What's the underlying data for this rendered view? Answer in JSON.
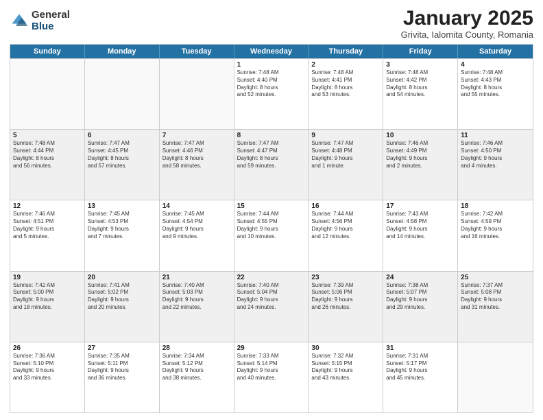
{
  "logo": {
    "general": "General",
    "blue": "Blue"
  },
  "title": "January 2025",
  "subtitle": "Grivita, Ialomita County, Romania",
  "days": [
    "Sunday",
    "Monday",
    "Tuesday",
    "Wednesday",
    "Thursday",
    "Friday",
    "Saturday"
  ],
  "weeks": [
    [
      {
        "day": "",
        "info": "",
        "shaded": false,
        "empty": true
      },
      {
        "day": "",
        "info": "",
        "shaded": false,
        "empty": true
      },
      {
        "day": "",
        "info": "",
        "shaded": false,
        "empty": true
      },
      {
        "day": "1",
        "info": "Sunrise: 7:48 AM\nSunset: 4:40 PM\nDaylight: 8 hours\nand 52 minutes.",
        "shaded": false,
        "empty": false
      },
      {
        "day": "2",
        "info": "Sunrise: 7:48 AM\nSunset: 4:41 PM\nDaylight: 8 hours\nand 53 minutes.",
        "shaded": false,
        "empty": false
      },
      {
        "day": "3",
        "info": "Sunrise: 7:48 AM\nSunset: 4:42 PM\nDaylight: 8 hours\nand 54 minutes.",
        "shaded": false,
        "empty": false
      },
      {
        "day": "4",
        "info": "Sunrise: 7:48 AM\nSunset: 4:43 PM\nDaylight: 8 hours\nand 55 minutes.",
        "shaded": false,
        "empty": false
      }
    ],
    [
      {
        "day": "5",
        "info": "Sunrise: 7:48 AM\nSunset: 4:44 PM\nDaylight: 8 hours\nand 56 minutes.",
        "shaded": true,
        "empty": false
      },
      {
        "day": "6",
        "info": "Sunrise: 7:47 AM\nSunset: 4:45 PM\nDaylight: 8 hours\nand 57 minutes.",
        "shaded": true,
        "empty": false
      },
      {
        "day": "7",
        "info": "Sunrise: 7:47 AM\nSunset: 4:46 PM\nDaylight: 8 hours\nand 58 minutes.",
        "shaded": true,
        "empty": false
      },
      {
        "day": "8",
        "info": "Sunrise: 7:47 AM\nSunset: 4:47 PM\nDaylight: 8 hours\nand 59 minutes.",
        "shaded": true,
        "empty": false
      },
      {
        "day": "9",
        "info": "Sunrise: 7:47 AM\nSunset: 4:48 PM\nDaylight: 9 hours\nand 1 minute.",
        "shaded": true,
        "empty": false
      },
      {
        "day": "10",
        "info": "Sunrise: 7:46 AM\nSunset: 4:49 PM\nDaylight: 9 hours\nand 2 minutes.",
        "shaded": true,
        "empty": false
      },
      {
        "day": "11",
        "info": "Sunrise: 7:46 AM\nSunset: 4:50 PM\nDaylight: 9 hours\nand 4 minutes.",
        "shaded": true,
        "empty": false
      }
    ],
    [
      {
        "day": "12",
        "info": "Sunrise: 7:46 AM\nSunset: 4:51 PM\nDaylight: 9 hours\nand 5 minutes.",
        "shaded": false,
        "empty": false
      },
      {
        "day": "13",
        "info": "Sunrise: 7:45 AM\nSunset: 4:53 PM\nDaylight: 9 hours\nand 7 minutes.",
        "shaded": false,
        "empty": false
      },
      {
        "day": "14",
        "info": "Sunrise: 7:45 AM\nSunset: 4:54 PM\nDaylight: 9 hours\nand 9 minutes.",
        "shaded": false,
        "empty": false
      },
      {
        "day": "15",
        "info": "Sunrise: 7:44 AM\nSunset: 4:55 PM\nDaylight: 9 hours\nand 10 minutes.",
        "shaded": false,
        "empty": false
      },
      {
        "day": "16",
        "info": "Sunrise: 7:44 AM\nSunset: 4:56 PM\nDaylight: 9 hours\nand 12 minutes.",
        "shaded": false,
        "empty": false
      },
      {
        "day": "17",
        "info": "Sunrise: 7:43 AM\nSunset: 4:58 PM\nDaylight: 9 hours\nand 14 minutes.",
        "shaded": false,
        "empty": false
      },
      {
        "day": "18",
        "info": "Sunrise: 7:42 AM\nSunset: 4:59 PM\nDaylight: 9 hours\nand 16 minutes.",
        "shaded": false,
        "empty": false
      }
    ],
    [
      {
        "day": "19",
        "info": "Sunrise: 7:42 AM\nSunset: 5:00 PM\nDaylight: 9 hours\nand 18 minutes.",
        "shaded": true,
        "empty": false
      },
      {
        "day": "20",
        "info": "Sunrise: 7:41 AM\nSunset: 5:02 PM\nDaylight: 9 hours\nand 20 minutes.",
        "shaded": true,
        "empty": false
      },
      {
        "day": "21",
        "info": "Sunrise: 7:40 AM\nSunset: 5:03 PM\nDaylight: 9 hours\nand 22 minutes.",
        "shaded": true,
        "empty": false
      },
      {
        "day": "22",
        "info": "Sunrise: 7:40 AM\nSunset: 5:04 PM\nDaylight: 9 hours\nand 24 minutes.",
        "shaded": true,
        "empty": false
      },
      {
        "day": "23",
        "info": "Sunrise: 7:39 AM\nSunset: 5:06 PM\nDaylight: 9 hours\nand 26 minutes.",
        "shaded": true,
        "empty": false
      },
      {
        "day": "24",
        "info": "Sunrise: 7:38 AM\nSunset: 5:07 PM\nDaylight: 9 hours\nand 29 minutes.",
        "shaded": true,
        "empty": false
      },
      {
        "day": "25",
        "info": "Sunrise: 7:37 AM\nSunset: 5:08 PM\nDaylight: 9 hours\nand 31 minutes.",
        "shaded": true,
        "empty": false
      }
    ],
    [
      {
        "day": "26",
        "info": "Sunrise: 7:36 AM\nSunset: 5:10 PM\nDaylight: 9 hours\nand 33 minutes.",
        "shaded": false,
        "empty": false
      },
      {
        "day": "27",
        "info": "Sunrise: 7:35 AM\nSunset: 5:11 PM\nDaylight: 9 hours\nand 36 minutes.",
        "shaded": false,
        "empty": false
      },
      {
        "day": "28",
        "info": "Sunrise: 7:34 AM\nSunset: 5:12 PM\nDaylight: 9 hours\nand 38 minutes.",
        "shaded": false,
        "empty": false
      },
      {
        "day": "29",
        "info": "Sunrise: 7:33 AM\nSunset: 5:14 PM\nDaylight: 9 hours\nand 40 minutes.",
        "shaded": false,
        "empty": false
      },
      {
        "day": "30",
        "info": "Sunrise: 7:32 AM\nSunset: 5:15 PM\nDaylight: 9 hours\nand 43 minutes.",
        "shaded": false,
        "empty": false
      },
      {
        "day": "31",
        "info": "Sunrise: 7:31 AM\nSunset: 5:17 PM\nDaylight: 9 hours\nand 45 minutes.",
        "shaded": false,
        "empty": false
      },
      {
        "day": "",
        "info": "",
        "shaded": false,
        "empty": true
      }
    ]
  ]
}
